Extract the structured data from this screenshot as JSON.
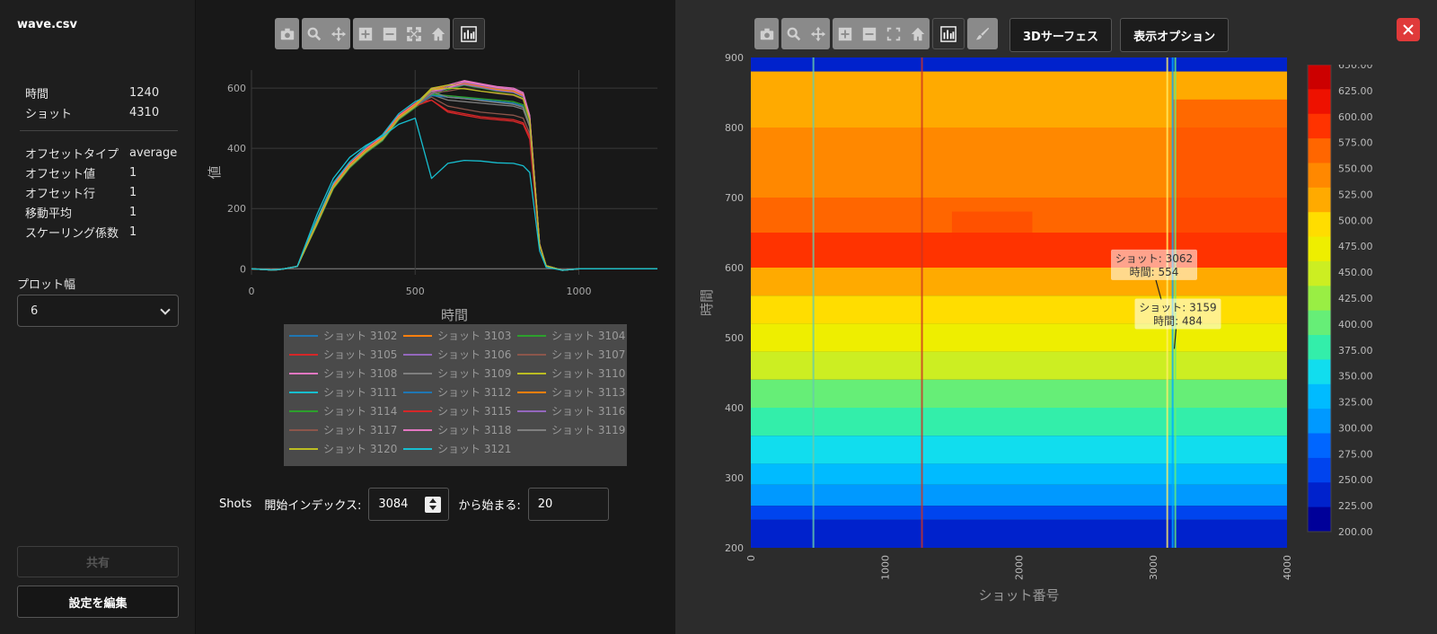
{
  "sidebar": {
    "file_name": "wave.csv",
    "info": [
      {
        "key": "時間",
        "value": "1240"
      },
      {
        "key": "ショット",
        "value": "4310"
      }
    ],
    "params": [
      {
        "key": "オフセットタイプ",
        "value": "average"
      },
      {
        "key": "オフセット値",
        "value": "1"
      },
      {
        "key": "オフセット行",
        "value": "1"
      },
      {
        "key": "移動平均",
        "value": "1"
      },
      {
        "key": "スケーリング係数",
        "value": "1"
      }
    ],
    "plot_width_label": "プロット幅",
    "plot_width_value": "6",
    "share_label": "共有",
    "edit_label": "設定を編集"
  },
  "toolbar_left": {
    "icons": [
      "camera-icon",
      "zoom-icon",
      "pan-icon",
      "zoom-in-icon",
      "zoom-out-icon",
      "autoscale-icon",
      "home-icon",
      "bar-chart-icon"
    ]
  },
  "toolbar_right": {
    "icons": [
      "camera-icon",
      "zoom-icon",
      "pan-icon",
      "zoom-in-icon",
      "zoom-out-icon",
      "autoscale-icon",
      "home-icon",
      "bar-chart-icon",
      "brush-icon"
    ],
    "surface_label": "3Dサーフェス",
    "options_label": "表示オプション"
  },
  "shots_controls": {
    "shots_label": "Shots",
    "start_index_label": "開始インデックス:",
    "start_index_value": "3084",
    "count_label": "から始まる:",
    "count_value": "20"
  },
  "colors": {
    "accent_close": "#e03a3a"
  },
  "chart_data": [
    {
      "type": "line",
      "title": "",
      "xlabel": "時間",
      "ylabel": "値",
      "xlim": [
        0,
        1240
      ],
      "ylim": [
        -20,
        660
      ],
      "x_ticks": [
        0,
        500,
        1000
      ],
      "y_ticks": [
        0,
        200,
        400,
        600
      ],
      "grid": true,
      "legend_placement": "bottom",
      "x": [
        0,
        60,
        80,
        100,
        140,
        200,
        250,
        300,
        350,
        400,
        450,
        500,
        550,
        600,
        650,
        700,
        750,
        800,
        830,
        850,
        880,
        900,
        950,
        1000,
        1240
      ],
      "series": [
        {
          "name": "ショット 3102",
          "color": "#1f77b4",
          "values": [
            0,
            -4,
            -3,
            0,
            8,
            150,
            270,
            340,
            390,
            430,
            500,
            540,
            580,
            600,
            615,
            605,
            595,
            590,
            575,
            500,
            80,
            10,
            -5,
            0,
            0
          ]
        },
        {
          "name": "ショット 3103",
          "color": "#ff7f0e",
          "values": [
            0,
            -4,
            -3,
            0,
            8,
            155,
            275,
            345,
            395,
            435,
            505,
            545,
            595,
            605,
            620,
            610,
            600,
            595,
            580,
            505,
            82,
            10,
            -5,
            0,
            0
          ]
        },
        {
          "name": "ショット 3104",
          "color": "#2ca02c",
          "values": [
            0,
            -4,
            -3,
            0,
            8,
            145,
            265,
            335,
            385,
            425,
            495,
            535,
            575,
            595,
            610,
            600,
            590,
            585,
            570,
            495,
            78,
            10,
            -5,
            0,
            0
          ]
        },
        {
          "name": "ショット 3105",
          "color": "#d62728",
          "values": [
            0,
            -4,
            -3,
            0,
            8,
            160,
            280,
            350,
            400,
            440,
            510,
            550,
            560,
            520,
            510,
            500,
            495,
            490,
            480,
            430,
            75,
            10,
            -5,
            0,
            0
          ]
        },
        {
          "name": "ショット 3106",
          "color": "#9467bd",
          "values": [
            0,
            -4,
            -3,
            0,
            8,
            150,
            270,
            340,
            390,
            430,
            500,
            540,
            585,
            605,
            618,
            608,
            598,
            592,
            578,
            503,
            80,
            10,
            -5,
            0,
            0
          ]
        },
        {
          "name": "ショット 3107",
          "color": "#8c564b",
          "values": [
            0,
            -4,
            -3,
            0,
            8,
            152,
            272,
            342,
            392,
            432,
            502,
            542,
            570,
            540,
            530,
            520,
            515,
            510,
            500,
            450,
            78,
            10,
            -5,
            0,
            0
          ]
        },
        {
          "name": "ショット 3108",
          "color": "#e377c2",
          "values": [
            0,
            -4,
            -3,
            0,
            8,
            158,
            278,
            348,
            398,
            438,
            508,
            548,
            598,
            610,
            625,
            615,
            605,
            600,
            585,
            510,
            84,
            10,
            -5,
            0,
            0
          ]
        },
        {
          "name": "ショット 3109",
          "color": "#7f7f7f",
          "values": [
            0,
            -4,
            -3,
            0,
            8,
            148,
            268,
            338,
            388,
            428,
            498,
            538,
            578,
            560,
            555,
            550,
            545,
            540,
            530,
            470,
            80,
            10,
            -5,
            0,
            0
          ]
        },
        {
          "name": "ショット 3110",
          "color": "#bcbd22",
          "values": [
            0,
            -4,
            -3,
            0,
            8,
            150,
            270,
            340,
            390,
            430,
            500,
            545,
            600,
            610,
            612,
            604,
            596,
            590,
            575,
            500,
            80,
            10,
            -5,
            0,
            0
          ]
        },
        {
          "name": "ショット 3111",
          "color": "#17becf",
          "values": [
            0,
            -4,
            -3,
            0,
            8,
            165,
            285,
            355,
            405,
            445,
            515,
            555,
            580,
            570,
            565,
            560,
            555,
            550,
            540,
            480,
            78,
            10,
            -5,
            0,
            0
          ]
        },
        {
          "name": "ショット 3112",
          "color": "#1f77b4",
          "values": [
            0,
            -4,
            -3,
            0,
            8,
            150,
            270,
            340,
            390,
            430,
            500,
            540,
            575,
            570,
            568,
            562,
            556,
            550,
            540,
            480,
            80,
            10,
            -5,
            0,
            0
          ]
        },
        {
          "name": "ショット 3113",
          "color": "#ff7f0e",
          "values": [
            0,
            -4,
            -3,
            0,
            8,
            155,
            275,
            345,
            395,
            435,
            505,
            545,
            590,
            600,
            615,
            605,
            595,
            590,
            575,
            500,
            80,
            10,
            -5,
            0,
            0
          ]
        },
        {
          "name": "ショット 3114",
          "color": "#2ca02c",
          "values": [
            0,
            -4,
            -3,
            0,
            8,
            150,
            270,
            340,
            390,
            430,
            500,
            540,
            580,
            575,
            570,
            565,
            560,
            555,
            545,
            485,
            80,
            10,
            -5,
            0,
            0
          ]
        },
        {
          "name": "ショット 3115",
          "color": "#d62728",
          "values": [
            0,
            -4,
            -3,
            0,
            8,
            150,
            270,
            340,
            390,
            430,
            500,
            540,
            560,
            525,
            515,
            505,
            500,
            495,
            485,
            440,
            78,
            10,
            -5,
            0,
            0
          ]
        },
        {
          "name": "ショット 3116",
          "color": "#9467bd",
          "values": [
            0,
            -4,
            -3,
            0,
            8,
            150,
            270,
            340,
            390,
            430,
            500,
            540,
            582,
            600,
            612,
            602,
            592,
            586,
            572,
            498,
            80,
            10,
            -5,
            0,
            0
          ]
        },
        {
          "name": "ショット 3117",
          "color": "#8c564b",
          "values": [
            0,
            -4,
            -3,
            0,
            8,
            150,
            270,
            340,
            390,
            430,
            500,
            540,
            585,
            590,
            600,
            590,
            582,
            576,
            562,
            490,
            80,
            10,
            -5,
            0,
            0
          ]
        },
        {
          "name": "ショット 3118",
          "color": "#e377c2",
          "values": [
            0,
            -4,
            -3,
            0,
            8,
            150,
            270,
            340,
            390,
            430,
            500,
            540,
            590,
            600,
            622,
            612,
            602,
            596,
            580,
            505,
            80,
            10,
            -5,
            0,
            0
          ]
        },
        {
          "name": "ショット 3119",
          "color": "#7f7f7f",
          "values": [
            0,
            -4,
            -3,
            0,
            8,
            150,
            270,
            340,
            390,
            430,
            500,
            540,
            588,
            570,
            565,
            558,
            552,
            546,
            536,
            476,
            80,
            10,
            -5,
            0,
            0
          ]
        },
        {
          "name": "ショット 3120",
          "color": "#bcbd22",
          "values": [
            0,
            -4,
            -3,
            0,
            8,
            150,
            270,
            340,
            390,
            430,
            500,
            540,
            595,
            600,
            598,
            590,
            584,
            578,
            565,
            495,
            80,
            10,
            -5,
            0,
            0
          ]
        },
        {
          "name": "ショット 3121",
          "color": "#17becf",
          "values": [
            0,
            -4,
            -3,
            0,
            8,
            180,
            300,
            370,
            410,
            440,
            480,
            500,
            300,
            350,
            360,
            358,
            352,
            350,
            342,
            320,
            60,
            5,
            -5,
            0,
            0
          ]
        }
      ]
    },
    {
      "type": "heatmap",
      "title": "",
      "xlabel": "ショット番号",
      "ylabel": "時間",
      "xlim": [
        0,
        4000
      ],
      "ylim": [
        200,
        900
      ],
      "x_ticks": [
        0,
        1000,
        2000,
        3000,
        4000
      ],
      "y_ticks": [
        200,
        300,
        400,
        500,
        600,
        700,
        800,
        900
      ],
      "colorbar": {
        "min": 200,
        "max": 650,
        "ticks": [
          "650.00",
          "625.00",
          "600.00",
          "575.00",
          "550.00",
          "525.00",
          "500.00",
          "475.00",
          "450.00",
          "425.00",
          "400.00",
          "375.00",
          "350.00",
          "325.00",
          "300.00",
          "275.00",
          "250.00",
          "225.00",
          "200.00"
        ],
        "colors": [
          "#cc0000",
          "#ee1100",
          "#ff3300",
          "#ff6600",
          "#ff8800",
          "#ffaa00",
          "#ffdd00",
          "#eeee00",
          "#ccee22",
          "#99ee44",
          "#66ee77",
          "#33eeaa",
          "#11ddee",
          "#00bbff",
          "#0099ff",
          "#0066ff",
          "#0044ee",
          "#0022cc",
          "#000099"
        ]
      },
      "rows": [
        {
          "time": 900,
          "value": 230
        },
        {
          "time": 880,
          "value": 520
        },
        {
          "time": 800,
          "value": 560
        },
        {
          "time": 700,
          "value": 575
        },
        {
          "time": 650,
          "value": 590
        },
        {
          "time": 600,
          "value": 530
        },
        {
          "time": 560,
          "value": 495
        },
        {
          "time": 520,
          "value": 475
        },
        {
          "time": 480,
          "value": 440
        },
        {
          "time": 440,
          "value": 400
        },
        {
          "time": 400,
          "value": 370
        },
        {
          "time": 360,
          "value": 345
        },
        {
          "time": 320,
          "value": 320
        },
        {
          "time": 290,
          "value": 290
        },
        {
          "time": 260,
          "value": 255
        },
        {
          "time": 240,
          "value": 220
        },
        {
          "time": 200,
          "value": 205
        }
      ],
      "annotations": [
        {
          "shot_label": "ショット",
          "shot": "3062",
          "time_label": "時間",
          "time": "554",
          "x": 3062,
          "y": 554
        },
        {
          "shot_label": "ショット",
          "shot": "3159",
          "time_label": "時間",
          "time": "484",
          "x": 3159,
          "y": 484
        }
      ]
    }
  ]
}
